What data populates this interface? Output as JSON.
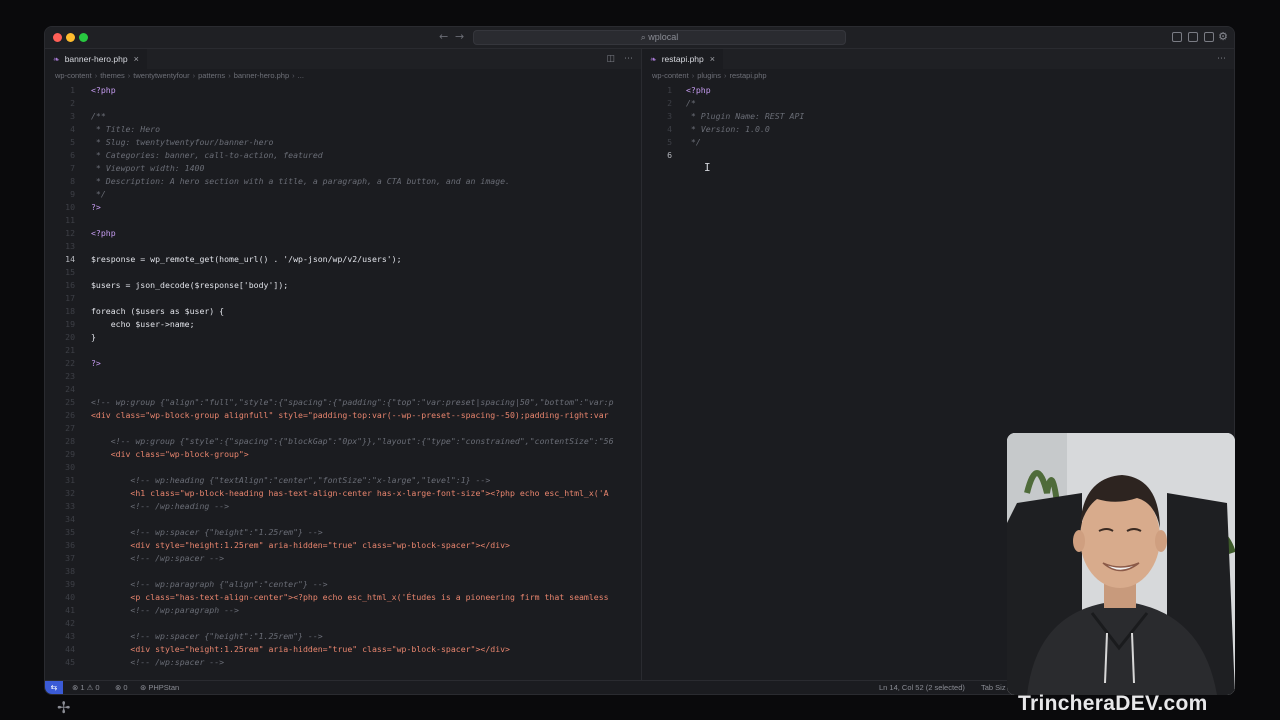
{
  "titlebar": {
    "search_text": "⌕ wplocal",
    "nav_back": "←",
    "nav_forward": "→",
    "gear": "⚙"
  },
  "left": {
    "tab_label": "banner-hero.php",
    "tab_icon": "php",
    "breadcrumbs": [
      "wp-content",
      "themes",
      "twentytwentyfour",
      "patterns",
      "banner-hero.php",
      "..."
    ],
    "lines": [
      {
        "n": "1",
        "t": "<?php",
        "c": "kw"
      },
      {
        "n": "2",
        "t": "",
        "c": ""
      },
      {
        "n": "3",
        "t": "/**",
        "c": "com"
      },
      {
        "n": "4",
        "t": " * Title: Hero",
        "c": "com"
      },
      {
        "n": "5",
        "t": " * Slug: twentytwentyfour/banner-hero",
        "c": "com"
      },
      {
        "n": "6",
        "t": " * Categories: banner, call-to-action, featured",
        "c": "com"
      },
      {
        "n": "7",
        "t": " * Viewport width: 1400",
        "c": "com"
      },
      {
        "n": "8",
        "t": " * Description: A hero section with a title, a paragraph, a CTA button, and an image.",
        "c": "com"
      },
      {
        "n": "9",
        "t": " */",
        "c": "com"
      },
      {
        "n": "10",
        "t": "?>",
        "c": "kw"
      },
      {
        "n": "11",
        "t": "",
        "c": ""
      },
      {
        "n": "12",
        "t": "<?php",
        "c": "kw"
      },
      {
        "n": "13",
        "t": "",
        "c": ""
      },
      {
        "n": "14",
        "t": "$response = wp_remote_get(home_url() . '/wp-json/wp/v2/users');",
        "c": "var",
        "active": true
      },
      {
        "n": "15",
        "t": "",
        "c": ""
      },
      {
        "n": "16",
        "t": "$users = json_decode($response['body']);",
        "c": "var"
      },
      {
        "n": "17",
        "t": "",
        "c": ""
      },
      {
        "n": "18",
        "t": "foreach ($users as $user) {",
        "c": "var"
      },
      {
        "n": "19",
        "t": "    echo $user->name;",
        "c": "var"
      },
      {
        "n": "20",
        "t": "}",
        "c": "var"
      },
      {
        "n": "21",
        "t": "",
        "c": ""
      },
      {
        "n": "22",
        "t": "?>",
        "c": "kw"
      },
      {
        "n": "23",
        "t": "",
        "c": ""
      },
      {
        "n": "24",
        "t": "",
        "c": ""
      },
      {
        "n": "25",
        "t": "<!-- wp:group {\"align\":\"full\",\"style\":{\"spacing\":{\"padding\":{\"top\":\"var:preset|spacing|50\",\"bottom\":\"var:p",
        "c": "com"
      },
      {
        "n": "26",
        "t": "<div class=\"wp-block-group alignfull\" style=\"padding-top:var(--wp--preset--spacing--50);padding-right:var",
        "c": "tag"
      },
      {
        "n": "27",
        "t": "",
        "c": ""
      },
      {
        "n": "28",
        "t": "    <!-- wp:group {\"style\":{\"spacing\":{\"blockGap\":\"0px\"}},\"layout\":{\"type\":\"constrained\",\"contentSize\":\"56",
        "c": "com"
      },
      {
        "n": "29",
        "t": "    <div class=\"wp-block-group\">",
        "c": "tag"
      },
      {
        "n": "30",
        "t": "",
        "c": ""
      },
      {
        "n": "31",
        "t": "        <!-- wp:heading {\"textAlign\":\"center\",\"fontSize\":\"x-large\",\"level\":1} -->",
        "c": "com"
      },
      {
        "n": "32",
        "t": "        <h1 class=\"wp-block-heading has-text-align-center has-x-large-font-size\"><?php echo esc_html_x('A",
        "c": "tag"
      },
      {
        "n": "33",
        "t": "        <!-- /wp:heading -->",
        "c": "com"
      },
      {
        "n": "34",
        "t": "",
        "c": ""
      },
      {
        "n": "35",
        "t": "        <!-- wp:spacer {\"height\":\"1.25rem\"} -->",
        "c": "com"
      },
      {
        "n": "36",
        "t": "        <div style=\"height:1.25rem\" aria-hidden=\"true\" class=\"wp-block-spacer\"></div>",
        "c": "tag"
      },
      {
        "n": "37",
        "t": "        <!-- /wp:spacer -->",
        "c": "com"
      },
      {
        "n": "38",
        "t": "",
        "c": ""
      },
      {
        "n": "39",
        "t": "        <!-- wp:paragraph {\"align\":\"center\"} -->",
        "c": "com"
      },
      {
        "n": "40",
        "t": "        <p class=\"has-text-align-center\"><?php echo esc_html_x('Études is a pioneering firm that seamless",
        "c": "tag"
      },
      {
        "n": "41",
        "t": "        <!-- /wp:paragraph -->",
        "c": "com"
      },
      {
        "n": "42",
        "t": "",
        "c": ""
      },
      {
        "n": "43",
        "t": "        <!-- wp:spacer {\"height\":\"1.25rem\"} -->",
        "c": "com"
      },
      {
        "n": "44",
        "t": "        <div style=\"height:1.25rem\" aria-hidden=\"true\" class=\"wp-block-spacer\"></div>",
        "c": "tag"
      },
      {
        "n": "45",
        "t": "        <!-- /wp:spacer -->",
        "c": "com"
      }
    ]
  },
  "right": {
    "tab_label": "restapi.php",
    "tab_icon": "php",
    "breadcrumbs": [
      "wp-content",
      "plugins",
      "restapi.php"
    ],
    "lines": [
      {
        "n": "1",
        "t": "<?php",
        "c": "kw"
      },
      {
        "n": "2",
        "t": "/*",
        "c": "com"
      },
      {
        "n": "3",
        "t": " * Plugin Name: REST API",
        "c": "com"
      },
      {
        "n": "4",
        "t": " * Version: 1.0.0",
        "c": "com"
      },
      {
        "n": "5",
        "t": " */",
        "c": "com"
      },
      {
        "n": "6",
        "t": "",
        "c": "",
        "active": true
      }
    ]
  },
  "statusbar": {
    "remote_icon": "⇆",
    "problems": "⊗ 1 ⚠ 0",
    "warnings": "⊗ 0",
    "extension": "⊛ PHPStan",
    "cursor_position": "Ln 14, Col 52 (2 selected)",
    "tab_size": "Tab Siz"
  },
  "watermark": "TrincheraDEV.com",
  "colors": {
    "accent": "#3b5bd6",
    "close": "#ff5f57",
    "minimize": "#febc2e",
    "maximize": "#28c840"
  }
}
